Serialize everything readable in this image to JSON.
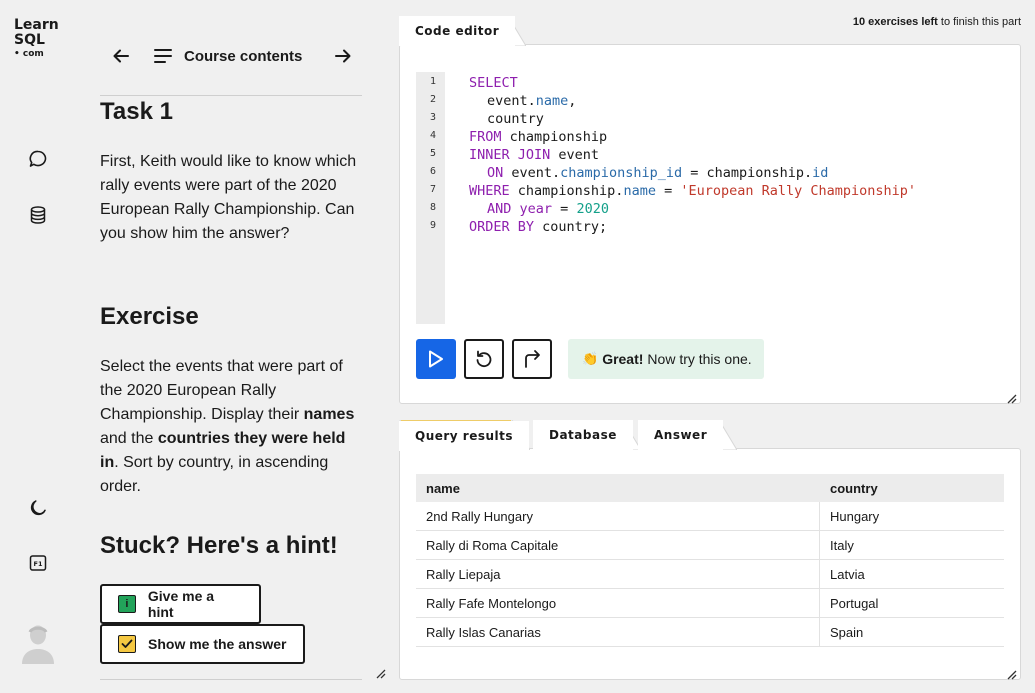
{
  "brand": {
    "line1": "Learn",
    "line2": "SQL",
    "line3": "• com"
  },
  "nav": {
    "toc_label": "Course contents"
  },
  "lesson": {
    "task_title": "Task 1",
    "task_text": "First, Keith would like to know which rally events were part of the 2020 European Rally Championship. Can you show him the answer?",
    "exercise_title": "Exercise",
    "exercise_text": {
      "p1": "Select the events that were part of the 2020 European Rally Championship. Display their ",
      "b1": "names",
      "p2": " and the ",
      "b2": "countries they were held in",
      "p3": ". Sort by country, in ascending order."
    },
    "stuck_title": "Stuck? Here's a hint!",
    "hint_button": "Give me a hint",
    "answer_button": "Show me the answer"
  },
  "editor": {
    "tab_label": "Code editor",
    "exercises_left_count": "10 exercises left",
    "exercises_left_suffix": " to finish this part",
    "line_numbers": [
      "1",
      "2",
      "3",
      "4",
      "5",
      "6",
      "7",
      "8",
      "9"
    ],
    "code": {
      "l1_kw": "SELECT",
      "l2_a": "event.",
      "l2_b": "name",
      "l2_c": ",",
      "l3": "country",
      "l4_kw": "FROM",
      "l4_rest": " championship",
      "l5_kw": "INNER JOIN",
      "l5_rest": " event",
      "l6_kw": "ON",
      "l6_a": " event.",
      "l6_b": "championship_id",
      "l6_c": " = championship.",
      "l6_d": "id",
      "l7_kw": "WHERE",
      "l7_a": " championship.",
      "l7_b": "name",
      "l7_c": " = ",
      "l7_str": "'European Rally Championship'",
      "l8_kw": "AND",
      "l8_a": " ",
      "l8_b": "year",
      "l8_c": " = ",
      "l8_num": "2020",
      "l9_kw": "ORDER BY",
      "l9_rest": " country;"
    },
    "feedback_emoji": "👏",
    "feedback_bold": "Great!",
    "feedback_text": "Now try this one."
  },
  "results": {
    "tabs": [
      "Query results",
      "Database",
      "Answer"
    ],
    "columns": [
      "name",
      "country"
    ],
    "rows": [
      [
        "2nd Rally Hungary",
        "Hungary"
      ],
      [
        "Rally di Roma Capitale",
        "Italy"
      ],
      [
        "Rally Liepaja",
        "Latvia"
      ],
      [
        "Rally Fafe Montelongo",
        "Portugal"
      ],
      [
        "Rally Islas Canarias",
        "Spain"
      ]
    ]
  },
  "colors": {
    "run_button": "#1666e6",
    "tab_accent": "#f5c842",
    "feedback_bg": "#e4f3ea",
    "hint_icon": "#22a35a",
    "answer_icon": "#f5c842"
  },
  "icons": [
    "chat-icon",
    "database-icon",
    "moon-icon",
    "f1-key-icon",
    "user-avatar-icon",
    "arrow-left-icon",
    "list-icon",
    "arrow-right-icon",
    "play-icon",
    "reset-icon",
    "step-icon"
  ]
}
